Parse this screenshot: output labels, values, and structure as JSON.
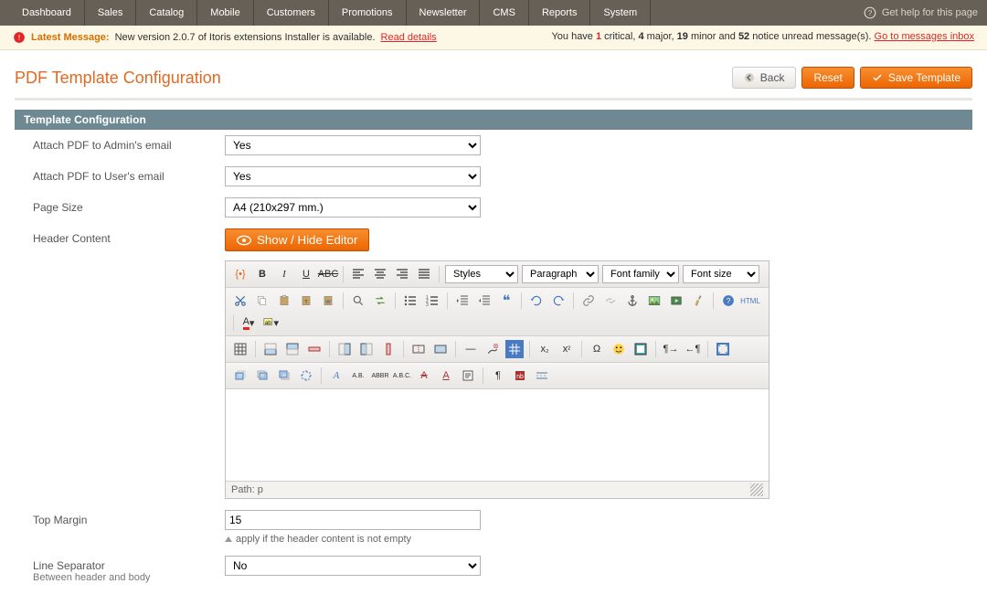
{
  "topnav": {
    "items": [
      "Dashboard",
      "Sales",
      "Catalog",
      "Mobile",
      "Customers",
      "Promotions",
      "Newsletter",
      "CMS",
      "Reports",
      "System"
    ],
    "help_text": "Get help for this page"
  },
  "messagebar": {
    "label": "Latest Message:",
    "text_before_link": "New version 2.0.7 of Itoris extensions Installer is available.",
    "link_text": "Read details",
    "right_prefix": "You have ",
    "critical": "1",
    "major": "4",
    "minor": "19",
    "notice": "52",
    "go_inbox": "Go to messages inbox"
  },
  "page": {
    "title": "PDF Template Configuration"
  },
  "buttons": {
    "back": "Back",
    "reset": "Reset",
    "save": "Save Template"
  },
  "section": {
    "header": "Template Configuration"
  },
  "fields": {
    "attach_admin": {
      "label": "Attach PDF to Admin's email",
      "value": "Yes"
    },
    "attach_user": {
      "label": "Attach PDF to User's email",
      "value": "Yes"
    },
    "page_size": {
      "label": "Page Size",
      "value": "A4 (210x297 mm.)"
    },
    "header_content": {
      "label": "Header Content",
      "toggle": "Show / Hide Editor",
      "path": "Path: p"
    },
    "top_margin": {
      "label": "Top Margin",
      "value": "15",
      "hint": "apply if the header content is not empty"
    },
    "line_sep": {
      "label": "Line Separator",
      "sub": "Between header and body",
      "value": "No"
    }
  },
  "wysiwyg": {
    "styles_placeholder": "Styles",
    "paragraph_placeholder": "Paragraph",
    "fontfamily_placeholder": "Font family",
    "fontsize_placeholder": "Font size",
    "html_label": "HTML"
  }
}
